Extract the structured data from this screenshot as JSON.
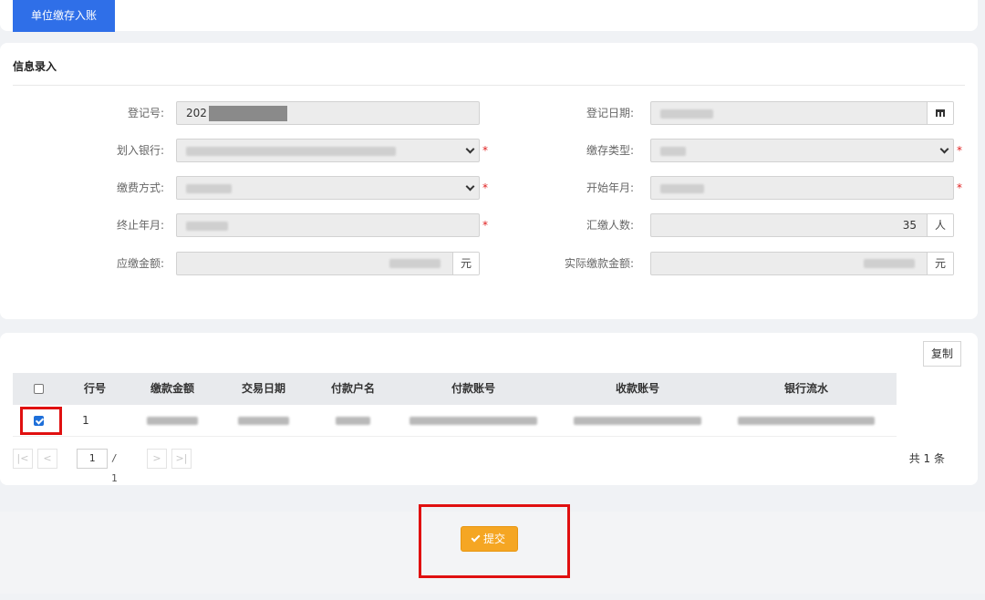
{
  "tabs": [
    {
      "label": "单位缴存入账",
      "active": true
    }
  ],
  "form": {
    "title": "信息录入",
    "fields": {
      "reg_no": {
        "label": "登记号:",
        "value": "202"
      },
      "reg_date": {
        "label": "登记日期:"
      },
      "bank": {
        "label": "划入银行:",
        "required": true
      },
      "deposit_type": {
        "label": "缴存类型:",
        "required": true
      },
      "pay_method": {
        "label": "缴费方式:",
        "required": true
      },
      "start_month": {
        "label": "开始年月:",
        "required": true
      },
      "end_month": {
        "label": "终止年月:",
        "required": true
      },
      "headcount": {
        "label": "汇缴人数:",
        "value": "35",
        "unit": "人"
      },
      "due_amount": {
        "label": "应缴金额:",
        "unit": "元"
      },
      "actual_amount": {
        "label": "实际缴款金额:",
        "unit": "元"
      }
    },
    "required_mark": "*"
  },
  "table": {
    "copy_label": "复制",
    "columns": [
      "行号",
      "缴款金额",
      "交易日期",
      "付款户名",
      "付款账号",
      "收款账号",
      "银行流水"
    ],
    "rows": [
      {
        "selected": true,
        "row_no": "1"
      }
    ],
    "pager": {
      "current": "1",
      "separator": "/",
      "total_pages": "1",
      "total_text": "共 1 条"
    }
  },
  "actions": {
    "submit_label": "提交"
  },
  "colors": {
    "primary": "#2f6fe8",
    "submit": "#f5a623",
    "highlight": "#e01010"
  }
}
